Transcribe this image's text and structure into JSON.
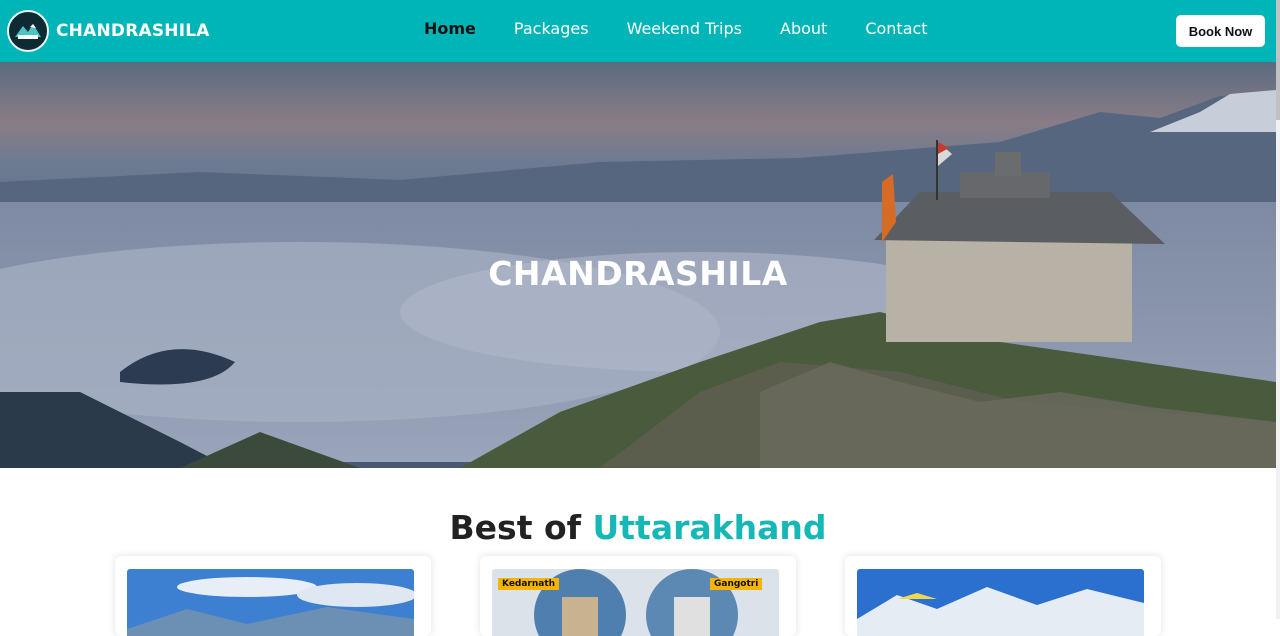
{
  "brand": {
    "name": "CHANDRASHILA",
    "logo_icon": "mountain-compass-logo-icon"
  },
  "nav": {
    "items": [
      {
        "label": "Home",
        "active": true
      },
      {
        "label": "Packages",
        "active": false
      },
      {
        "label": "Weekend Trips",
        "active": false
      },
      {
        "label": "About",
        "active": false
      },
      {
        "label": "Contact",
        "active": false
      }
    ],
    "cta_label": "Book Now"
  },
  "hero": {
    "title": "CHANDRASHILA"
  },
  "section": {
    "title_prefix": "Best of",
    "title_accent": "Uttarakhand"
  },
  "cards": [
    {
      "caption": ""
    },
    {
      "tags": [
        "Kedarnath",
        "Gangotri"
      ]
    },
    {
      "caption": ""
    }
  ],
  "colors": {
    "primary": "#00b5b8",
    "accent_text": "#17b7b8",
    "tag": "#f4b400"
  }
}
